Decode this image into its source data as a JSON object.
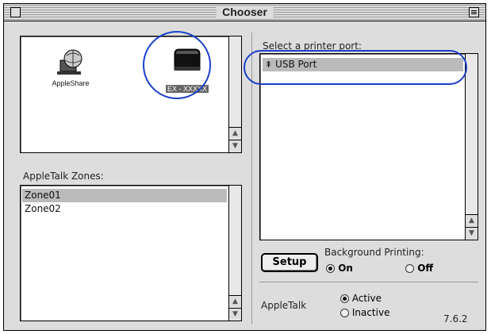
{
  "window": {
    "title": "Chooser",
    "version": "7.6.2"
  },
  "devices": {
    "items": [
      {
        "label": "AppleShare",
        "icon": "appleshare-icon"
      },
      {
        "label": "EX - XXXXX",
        "icon": "printer-icon",
        "selected": true
      }
    ]
  },
  "zones": {
    "heading": "AppleTalk Zones:",
    "items": [
      {
        "label": "Zone01",
        "selected": true
      },
      {
        "label": "Zone02",
        "selected": false
      }
    ]
  },
  "ports": {
    "heading": "Select a printer port:",
    "items": [
      {
        "label": "USB Port",
        "icon": "usb-icon",
        "selected": true
      }
    ]
  },
  "setup": {
    "label": "Setup"
  },
  "background_printing": {
    "label": "Background Printing:",
    "on_label": "On",
    "off_label": "Off",
    "selected": "On"
  },
  "appletalk": {
    "label": "AppleTalk",
    "active_label": "Active",
    "inactive_label": "Inactive",
    "selected": "Active"
  },
  "colors": {
    "annotation": "#1a3fc9",
    "window_bg": "#dddddd",
    "selection": "#bbbbbb"
  }
}
